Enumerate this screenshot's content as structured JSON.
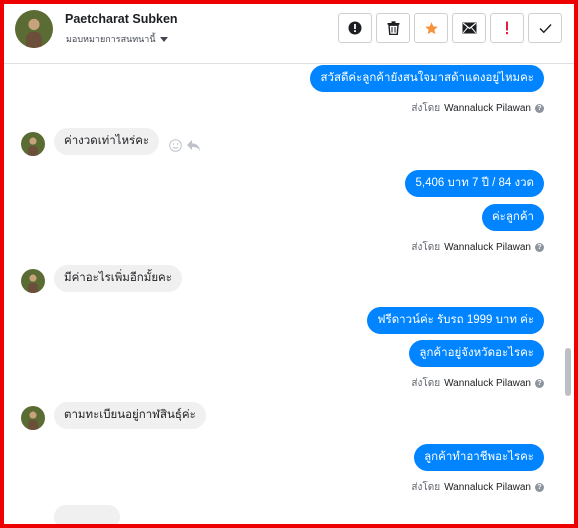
{
  "header": {
    "contact_name": "Paetcharat Subken",
    "assign_label": "มอบหมายการสนทนานี้",
    "actions": [
      {
        "name": "spam-icon",
        "color": "#1c1e21"
      },
      {
        "name": "trash-icon",
        "color": "#1c1e21"
      },
      {
        "name": "star-icon",
        "color": "#f7923b"
      },
      {
        "name": "mail-icon",
        "color": "#1c1e21"
      },
      {
        "name": "important-icon",
        "color": "#e41e3f"
      },
      {
        "name": "check-icon",
        "color": "#1c1e21"
      }
    ]
  },
  "messages": [
    {
      "dir": "out",
      "text": "สวัสดีค่ะลูกค้ายังสนใจมาสด้าแดงอยู่ไหมคะ"
    },
    {
      "sent_prefix": "ส่งโดย",
      "sender": "Wannaluck Pilawan"
    },
    {
      "dir": "in",
      "text": "ค่างวดเท่าไหร่คะ"
    },
    {
      "dir": "out",
      "text": "5,406 บาท  7 ปี / 84 งวด"
    },
    {
      "dir": "out",
      "text": "ค่ะลูกค้า"
    },
    {
      "sent_prefix": "ส่งโดย",
      "sender": "Wannaluck Pilawan"
    },
    {
      "dir": "in",
      "text": "มีค่าอะไรเพิ่มอีกมั้ยคะ"
    },
    {
      "dir": "out",
      "text": "ฟรีดาวน์ค่ะ รับรถ 1999  บาท ค่ะ"
    },
    {
      "dir": "out",
      "text": "ลูกค้าอยู่จังหวัดอะไรคะ"
    },
    {
      "sent_prefix": "ส่งโดย",
      "sender": "Wannaluck Pilawan"
    },
    {
      "dir": "in",
      "text": "ตามทะเบียนอยู่กาฬสินธุ์ค่ะ"
    },
    {
      "dir": "out",
      "text": "ลูกค้าทำอาชีพอะไรคะ"
    },
    {
      "sent_prefix": "ส่งโดย",
      "sender": "Wannaluck Pilawan"
    }
  ],
  "help_mark": "?",
  "colors": {
    "accent_blue": "#0084ff",
    "incoming_bg": "#f1f0f0",
    "frame_border": "#ee0000"
  }
}
